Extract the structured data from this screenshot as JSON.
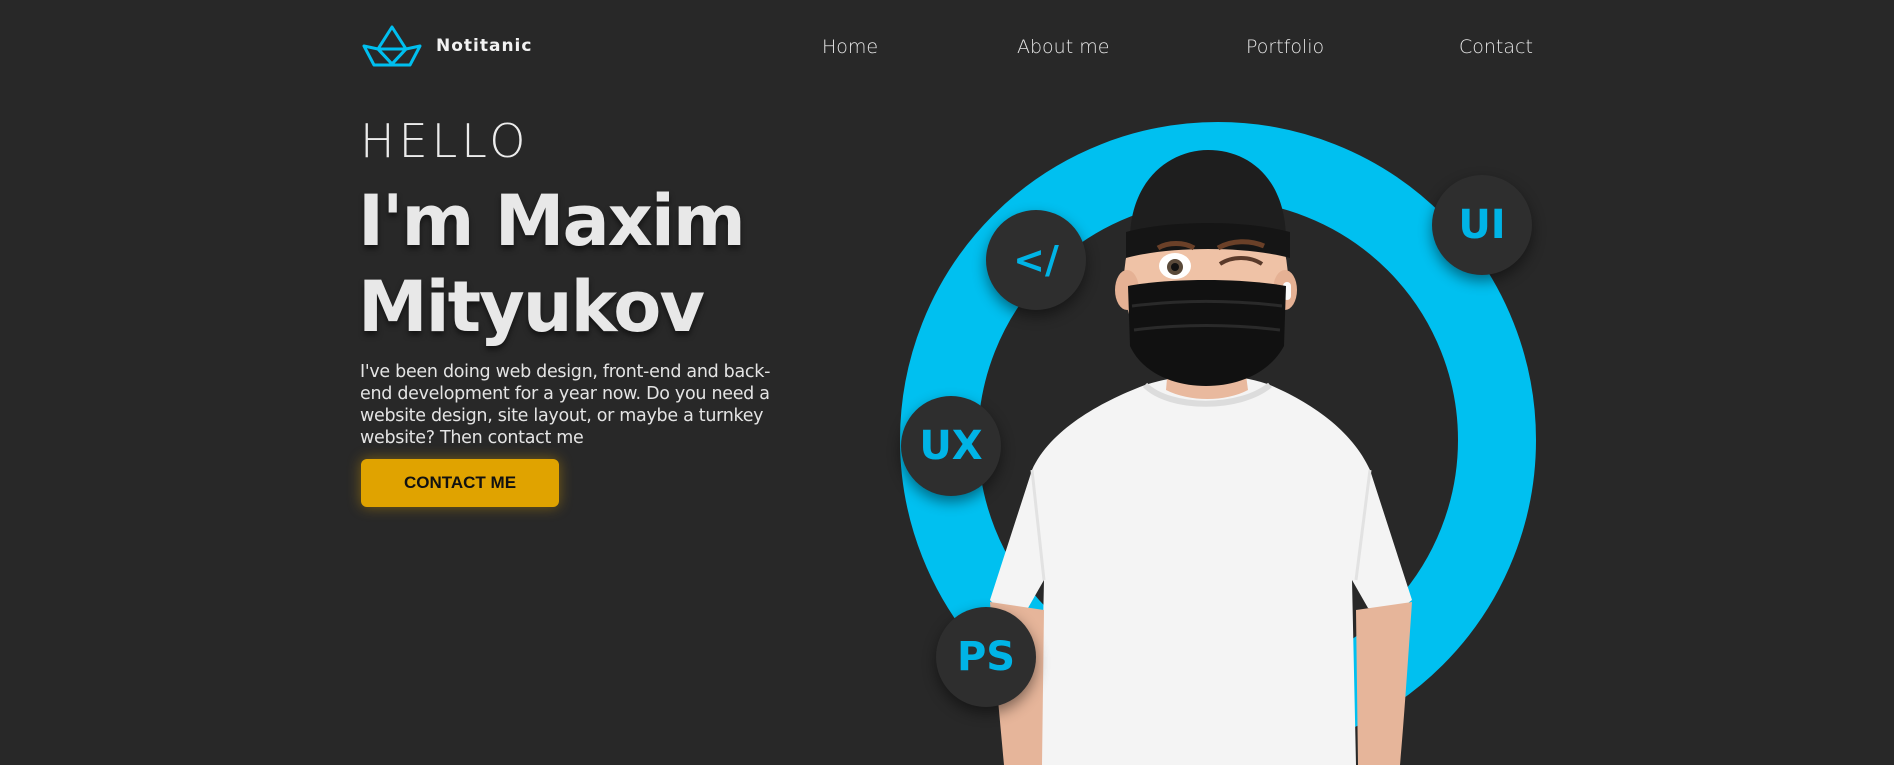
{
  "brand": {
    "name": "Notitanic"
  },
  "nav": {
    "items": [
      "Home",
      "About me",
      "Portfolio",
      "Contact"
    ]
  },
  "hero": {
    "greeting": "HELLO",
    "name_line1": "I'm Maxim",
    "name_line2": "Mityukov",
    "description": "I've been doing web design, front-end and back-end development for a year now. Do you need a website design, site layout, or maybe a turnkey website? Then contact me",
    "cta_label": "CONTACT ME"
  },
  "skills": {
    "badges": [
      "</",
      "UI",
      "UX",
      "PS"
    ]
  },
  "colors": {
    "background": "#282828",
    "accent_blue": "#00c0f0",
    "accent_yellow": "#e0a300",
    "badge_bg": "#2e2e2e"
  },
  "icons": {
    "logo": "paper-boat-icon"
  }
}
